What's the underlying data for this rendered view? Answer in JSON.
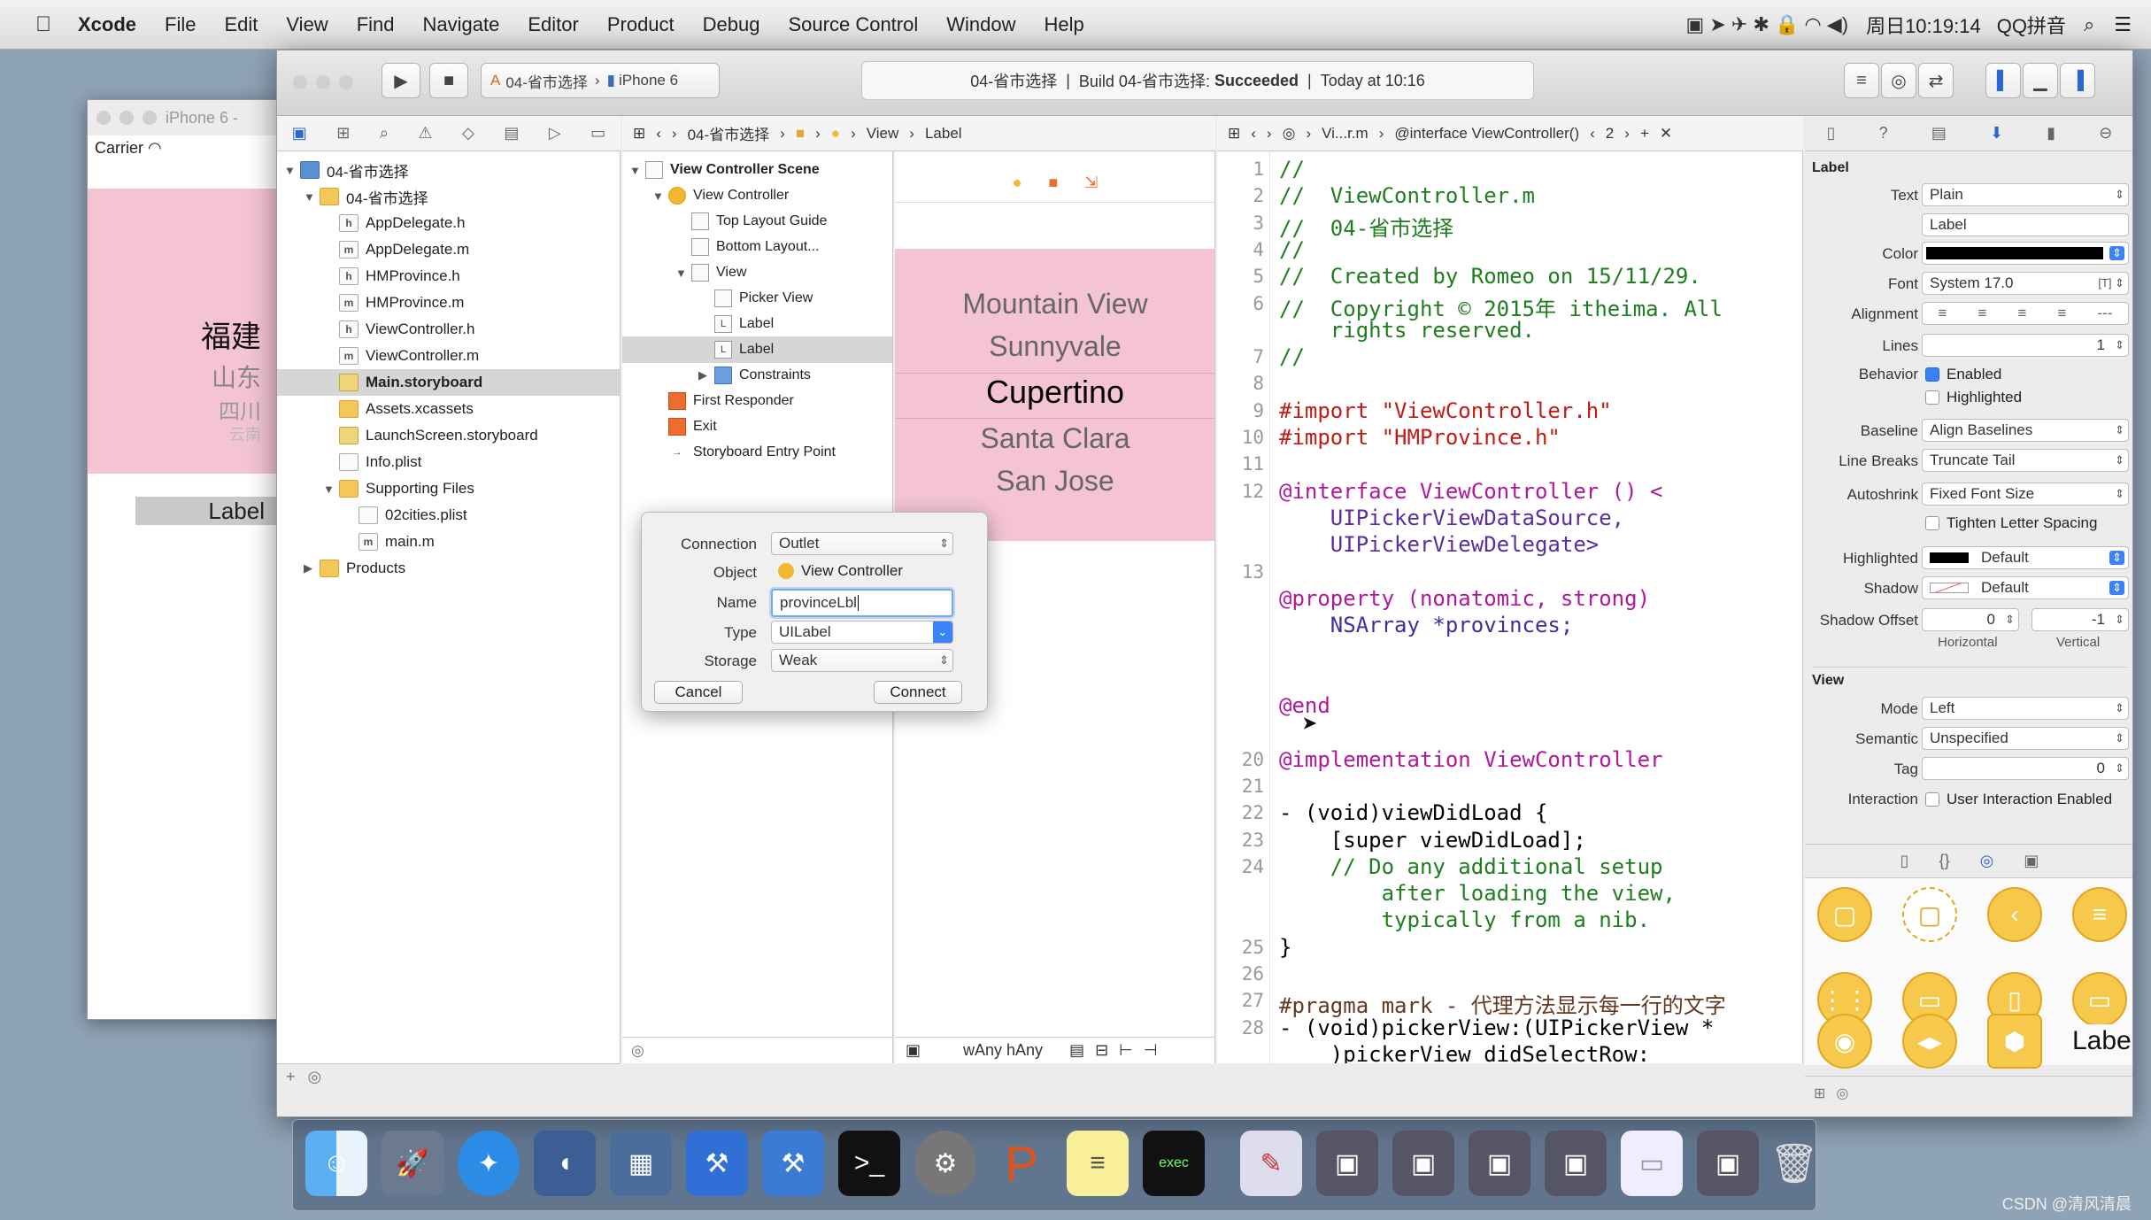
{
  "menubar": {
    "apple": "",
    "app_name": "Xcode",
    "items": [
      "File",
      "Edit",
      "View",
      "Find",
      "Navigate",
      "Editor",
      "Product",
      "Debug",
      "Source Control",
      "Window",
      "Help"
    ],
    "clock": "周日10:19:14",
    "input_method": "QQ拼音"
  },
  "simulator": {
    "title": "iPhone 6 -",
    "carrier": "Carrier",
    "picker_rows": [
      "福建",
      "山东",
      "四川",
      "云南"
    ],
    "label_text": "Label"
  },
  "toolbar": {
    "scheme": "04-省市选择",
    "device": "iPhone 6",
    "activity_project": "04-省市选择",
    "activity_build": "Build 04-省市选择:",
    "activity_status": "Succeeded",
    "activity_time": "Today at 10:16"
  },
  "jumpbar_storyboard": {
    "items": [
      "04-省市选择",
      "View",
      "Label"
    ]
  },
  "jumpbar_editor": {
    "items": [
      "Vi...r.m",
      "@interface ViewController()",
      "2"
    ]
  },
  "navigator": {
    "items": [
      {
        "label": "04-省市选择",
        "kind": "proj",
        "indent": 0,
        "disc": "▼"
      },
      {
        "label": "04-省市选择",
        "kind": "folder",
        "indent": 1,
        "disc": "▼"
      },
      {
        "label": "AppDelegate.h",
        "kind": "h",
        "indent": 2,
        "disc": ""
      },
      {
        "label": "AppDelegate.m",
        "kind": "m",
        "indent": 2,
        "disc": ""
      },
      {
        "label": "HMProvince.h",
        "kind": "h",
        "indent": 2,
        "disc": ""
      },
      {
        "label": "HMProvince.m",
        "kind": "m",
        "indent": 2,
        "disc": ""
      },
      {
        "label": "ViewController.h",
        "kind": "h",
        "indent": 2,
        "disc": ""
      },
      {
        "label": "ViewController.m",
        "kind": "m",
        "indent": 2,
        "disc": ""
      },
      {
        "label": "Main.storyboard",
        "kind": "sb",
        "indent": 2,
        "disc": "",
        "selected": true
      },
      {
        "label": "Assets.xcassets",
        "kind": "folder",
        "indent": 2,
        "disc": ""
      },
      {
        "label": "LaunchScreen.storyboard",
        "kind": "sb",
        "indent": 2,
        "disc": ""
      },
      {
        "label": "Info.plist",
        "kind": "pl",
        "indent": 2,
        "disc": ""
      },
      {
        "label": "Supporting Files",
        "kind": "folder",
        "indent": 2,
        "disc": "▼"
      },
      {
        "label": "02cities.plist",
        "kind": "pl",
        "indent": 3,
        "disc": ""
      },
      {
        "label": "main.m",
        "kind": "m",
        "indent": 3,
        "disc": ""
      },
      {
        "label": "Products",
        "kind": "folder",
        "indent": 1,
        "disc": "▶"
      }
    ]
  },
  "outline": {
    "items": [
      {
        "label": "View Controller Scene",
        "indent": 0,
        "disc": "▼",
        "icon": "",
        "bold": true
      },
      {
        "label": "View Controller",
        "indent": 1,
        "disc": "▼",
        "icon": "yel"
      },
      {
        "label": "Top Layout Guide",
        "indent": 2,
        "disc": "",
        "icon": "box"
      },
      {
        "label": "Bottom Layout...",
        "indent": 2,
        "disc": "",
        "icon": "box"
      },
      {
        "label": "View",
        "indent": 2,
        "disc": "▼",
        "icon": "box"
      },
      {
        "label": "Picker View",
        "indent": 3,
        "disc": "",
        "icon": "box"
      },
      {
        "label": "Label",
        "indent": 3,
        "disc": "",
        "icon": "L"
      },
      {
        "label": "Label",
        "indent": 3,
        "disc": "",
        "icon": "L",
        "selected": true
      },
      {
        "label": "Constraints",
        "indent": 3,
        "disc": "▶",
        "icon": "blu"
      },
      {
        "label": "First Responder",
        "indent": 1,
        "disc": "",
        "icon": "ora"
      },
      {
        "label": "Exit",
        "indent": 1,
        "disc": "",
        "icon": "ora"
      },
      {
        "label": "Storyboard Entry Point",
        "indent": 1,
        "disc": "",
        "icon": "arrow"
      }
    ]
  },
  "canvas": {
    "picker_rows": [
      "Mountain View",
      "Sunnyvale",
      "Cupertino",
      "Santa Clara",
      "San Jose"
    ],
    "size_class": "wAny hAny"
  },
  "connection_popover": {
    "connection_label": "Connection",
    "connection_value": "Outlet",
    "object_label": "Object",
    "object_value": "View Controller",
    "name_label": "Name",
    "name_value": "provinceLbl",
    "type_label": "Type",
    "type_value": "UILabel",
    "storage_label": "Storage",
    "storage_value": "Weak",
    "cancel": "Cancel",
    "connect": "Connect"
  },
  "editor": {
    "lines": [
      {
        "n": "1",
        "t": "//",
        "c": "c-com"
      },
      {
        "n": "2",
        "t": "//  ViewController.m",
        "c": "c-com"
      },
      {
        "n": "3",
        "t": "//  04-省市选择",
        "c": "c-com"
      },
      {
        "n": "4",
        "t": "//",
        "c": "c-com"
      },
      {
        "n": "5",
        "t": "//  Created by Romeo on 15/11/29.",
        "c": "c-com"
      },
      {
        "n": "6",
        "t": "//  Copyright © 2015年 itheima. All",
        "c": "c-com"
      },
      {
        "n": "",
        "t": "    rights reserved.",
        "c": "c-com"
      },
      {
        "n": "7",
        "t": "//",
        "c": "c-com"
      },
      {
        "n": "8",
        "t": "",
        "c": ""
      },
      {
        "n": "9",
        "t": "#import \"ViewController.h\"",
        "c": "c-str"
      },
      {
        "n": "10",
        "t": "#import \"HMProvince.h\"",
        "c": "c-str"
      },
      {
        "n": "11",
        "t": "",
        "c": ""
      },
      {
        "n": "12",
        "t": "@interface ViewController () <",
        "c": "c-kw"
      },
      {
        "n": "",
        "t": "    UIPickerViewDataSource,",
        "c": "c-cls"
      },
      {
        "n": "",
        "t": "    UIPickerViewDelegate>",
        "c": "c-cls"
      },
      {
        "n": "13",
        "t": "",
        "c": ""
      },
      {
        "n": "",
        "t": "@property (nonatomic, strong)",
        "c": "c-kw"
      },
      {
        "n": "",
        "t": "    NSArray *provinces;",
        "c": "c-type"
      },
      {
        "n": "",
        "t": "",
        "c": ""
      },
      {
        "n": "",
        "t": "",
        "c": ""
      },
      {
        "n": "",
        "t": "@end",
        "c": "c-kw"
      },
      {
        "n": "",
        "t": "",
        "c": ""
      },
      {
        "n": "20",
        "t": "@implementation ViewController",
        "c": "c-kw"
      },
      {
        "n": "21",
        "t": "",
        "c": ""
      },
      {
        "n": "22",
        "t": "- (void)viewDidLoad {",
        "c": ""
      },
      {
        "n": "23",
        "t": "    [super viewDidLoad];",
        "c": ""
      },
      {
        "n": "24",
        "t": "    // Do any additional setup",
        "c": "c-com"
      },
      {
        "n": "",
        "t": "        after loading the view,",
        "c": "c-com"
      },
      {
        "n": "",
        "t": "        typically from a nib.",
        "c": "c-com"
      },
      {
        "n": "25",
        "t": "}",
        "c": ""
      },
      {
        "n": "26",
        "t": "",
        "c": ""
      },
      {
        "n": "27",
        "t": "#pragma mark - 代理方法显示每一行的文字",
        "c": "c-pp"
      },
      {
        "n": "28",
        "t": "- (void)pickerView:(UIPickerView *",
        "c": ""
      },
      {
        "n": "",
        "t": "    )pickerView didSelectRow:",
        "c": ""
      }
    ]
  },
  "inspector": {
    "section_label": "Label",
    "text_label": "Text",
    "text_value": "Plain",
    "text_content": "Label",
    "color_label": "Color",
    "font_label": "Font",
    "font_value": "System 17.0",
    "alignment_label": "Alignment",
    "lines_label": "Lines",
    "lines_value": "1",
    "behavior_label": "Behavior",
    "enabled": "Enabled",
    "highlighted_chk": "Highlighted",
    "baseline_label": "Baseline",
    "baseline_value": "Align Baselines",
    "linebreaks_label": "Line Breaks",
    "linebreaks_value": "Truncate Tail",
    "autoshrink_label": "Autoshrink",
    "autoshrink_value": "Fixed Font Size",
    "tighten": "Tighten Letter Spacing",
    "highlighted_label": "Highlighted",
    "highlighted_value": "Default",
    "shadow_label": "Shadow",
    "shadow_value": "Default",
    "shadow_offset_label": "Shadow Offset",
    "shadow_h": "0",
    "shadow_v": "-1",
    "horizontal": "Horizontal",
    "vertical": "Vertical",
    "view_section": "View",
    "mode_label": "Mode",
    "mode_value": "Left",
    "semantic_label": "Semantic",
    "semantic_value": "Unspecified",
    "tag_label": "Tag",
    "tag_value": "0",
    "interaction_label": "Interaction",
    "interaction_value": "User Interaction Enabled",
    "library_label_obj": "Label"
  },
  "watermark": "CSDN @清风清晨"
}
